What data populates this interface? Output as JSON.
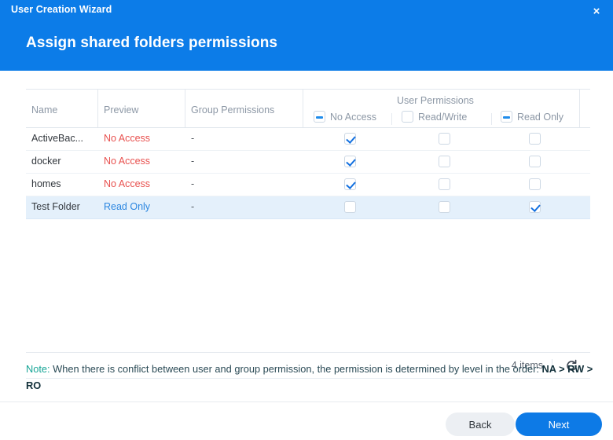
{
  "window": {
    "title": "User Creation Wizard",
    "close_label": "×",
    "heading": "Assign shared folders permissions",
    "accent_color": "#0c7ce8"
  },
  "table": {
    "columns": {
      "name": "Name",
      "preview": "Preview",
      "group_permissions": "Group Permissions",
      "user_permissions": "User Permissions"
    },
    "user_permission_columns": [
      {
        "label": "No Access",
        "state": "indeterminate"
      },
      {
        "label": "Read/Write",
        "state": "unchecked"
      },
      {
        "label": "Read Only",
        "state": "indeterminate"
      }
    ],
    "rows": [
      {
        "name": "ActiveBac...",
        "preview": "No Access",
        "preview_kind": "noaccess",
        "group_permissions": "-",
        "no_access": true,
        "read_write": false,
        "read_only": false,
        "selected": false
      },
      {
        "name": "docker",
        "preview": "No Access",
        "preview_kind": "noaccess",
        "group_permissions": "-",
        "no_access": true,
        "read_write": false,
        "read_only": false,
        "selected": false
      },
      {
        "name": "homes",
        "preview": "No Access",
        "preview_kind": "noaccess",
        "group_permissions": "-",
        "no_access": true,
        "read_write": false,
        "read_only": false,
        "selected": false
      },
      {
        "name": "Test Folder",
        "preview": "Read Only",
        "preview_kind": "readonly",
        "group_permissions": "-",
        "no_access": false,
        "read_write": false,
        "read_only": true,
        "selected": true
      }
    ],
    "footer": {
      "item_count": "4 items",
      "refresh_icon": "refresh-icon"
    }
  },
  "note": {
    "label": "Note:",
    "body": " When there is conflict between user and group permission, the permission is determined by level in the order: ",
    "order": "NA > RW > RO"
  },
  "buttons": {
    "back": "Back",
    "next": "Next"
  }
}
